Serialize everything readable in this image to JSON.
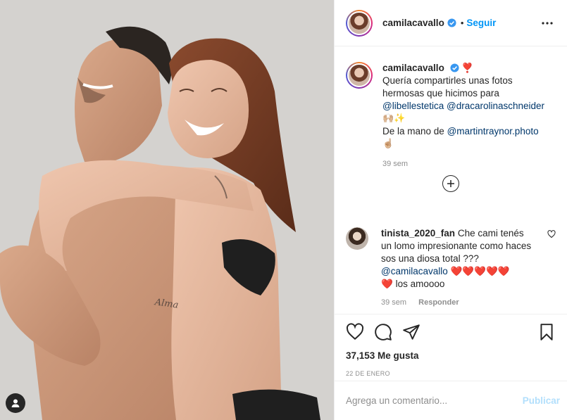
{
  "post": {
    "image_alt": "Foto",
    "author": {
      "username": "camilacavallo",
      "verified": true,
      "follow_label": "Seguir",
      "separator": "•"
    },
    "caption": {
      "username": "camilacavallo",
      "emoji_after_name": "❣️",
      "text_1": "Quería compartirles unas fotos hermosas que hicimos para",
      "mention_1": "@libellestetica",
      "mention_2": "@dracarolinaschneider",
      "emoji_line": "🙌🏼✨",
      "text_2": "De la mano de",
      "mention_3": "@martintraynor.photo",
      "emoji_end": "☝🏼",
      "age": "39 sem"
    },
    "comments": [
      {
        "username": "tinista_2020_fan",
        "text": "Che cami tenés un lomo impresionante como haces sos una diosa total ???",
        "mention": "@camilacavallo",
        "hearts": "❤️❤️❤️❤️❤️",
        "heart_2": "❤️",
        "tail": "los amoooo",
        "age": "39 sem",
        "reply_label": "Responder"
      }
    ],
    "likes": "37,153 Me gusta",
    "date": "22 DE ENERO",
    "add_comment_placeholder": "Agrega un comentario...",
    "publish_label": "Publicar"
  },
  "icons": {
    "like": "heart-outline-icon",
    "comment": "comment-bubble-icon",
    "share": "paper-plane-icon",
    "save": "bookmark-icon",
    "more": "more-dots-icon",
    "load_more": "plus-circle-icon",
    "tag": "user-tag-icon"
  },
  "colors": {
    "link_blue": "#0095f6",
    "mention": "#00376b",
    "muted": "#8e8e8e",
    "publish_disabled": "#b2dffc"
  }
}
